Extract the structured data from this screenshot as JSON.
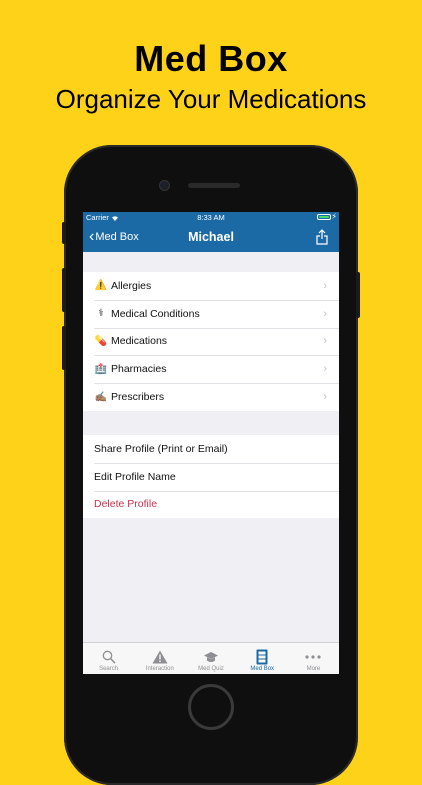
{
  "promo": {
    "title": "Med Box",
    "subtitle": "Organize Your Medications"
  },
  "status_bar": {
    "carrier": "Carrier",
    "time": "8:33 AM"
  },
  "nav": {
    "back_label": "Med Box",
    "title": "Michael"
  },
  "profile_sections": [
    {
      "icon": "⚠️",
      "icon_name": "warning-icon",
      "label": "Allergies"
    },
    {
      "icon": "⚕",
      "icon_name": "medical-icon",
      "label": "Medical Conditions"
    },
    {
      "icon": "💊",
      "icon_name": "pill-icon",
      "label": "Medications"
    },
    {
      "icon": "🏥",
      "icon_name": "hospital-icon",
      "label": "Pharmacies"
    },
    {
      "icon": "✍🏽",
      "icon_name": "writing-hand-icon",
      "label": "Prescribers"
    }
  ],
  "actions": {
    "share": "Share Profile (Print or Email)",
    "edit": "Edit Profile Name",
    "delete": "Delete Profile"
  },
  "tabs": [
    {
      "label": "Search",
      "icon_name": "search-icon"
    },
    {
      "label": "Interaction",
      "icon_name": "warning-icon"
    },
    {
      "label": "Med Quiz",
      "icon_name": "graduation-cap-icon"
    },
    {
      "label": "Med Box",
      "icon_name": "cabinet-icon"
    },
    {
      "label": "More",
      "icon_name": "more-icon"
    }
  ],
  "colors": {
    "background": "#FFD21A",
    "nav": "#1B6AA5",
    "danger": "#C8324D",
    "active_tab": "#1B6AA5"
  }
}
